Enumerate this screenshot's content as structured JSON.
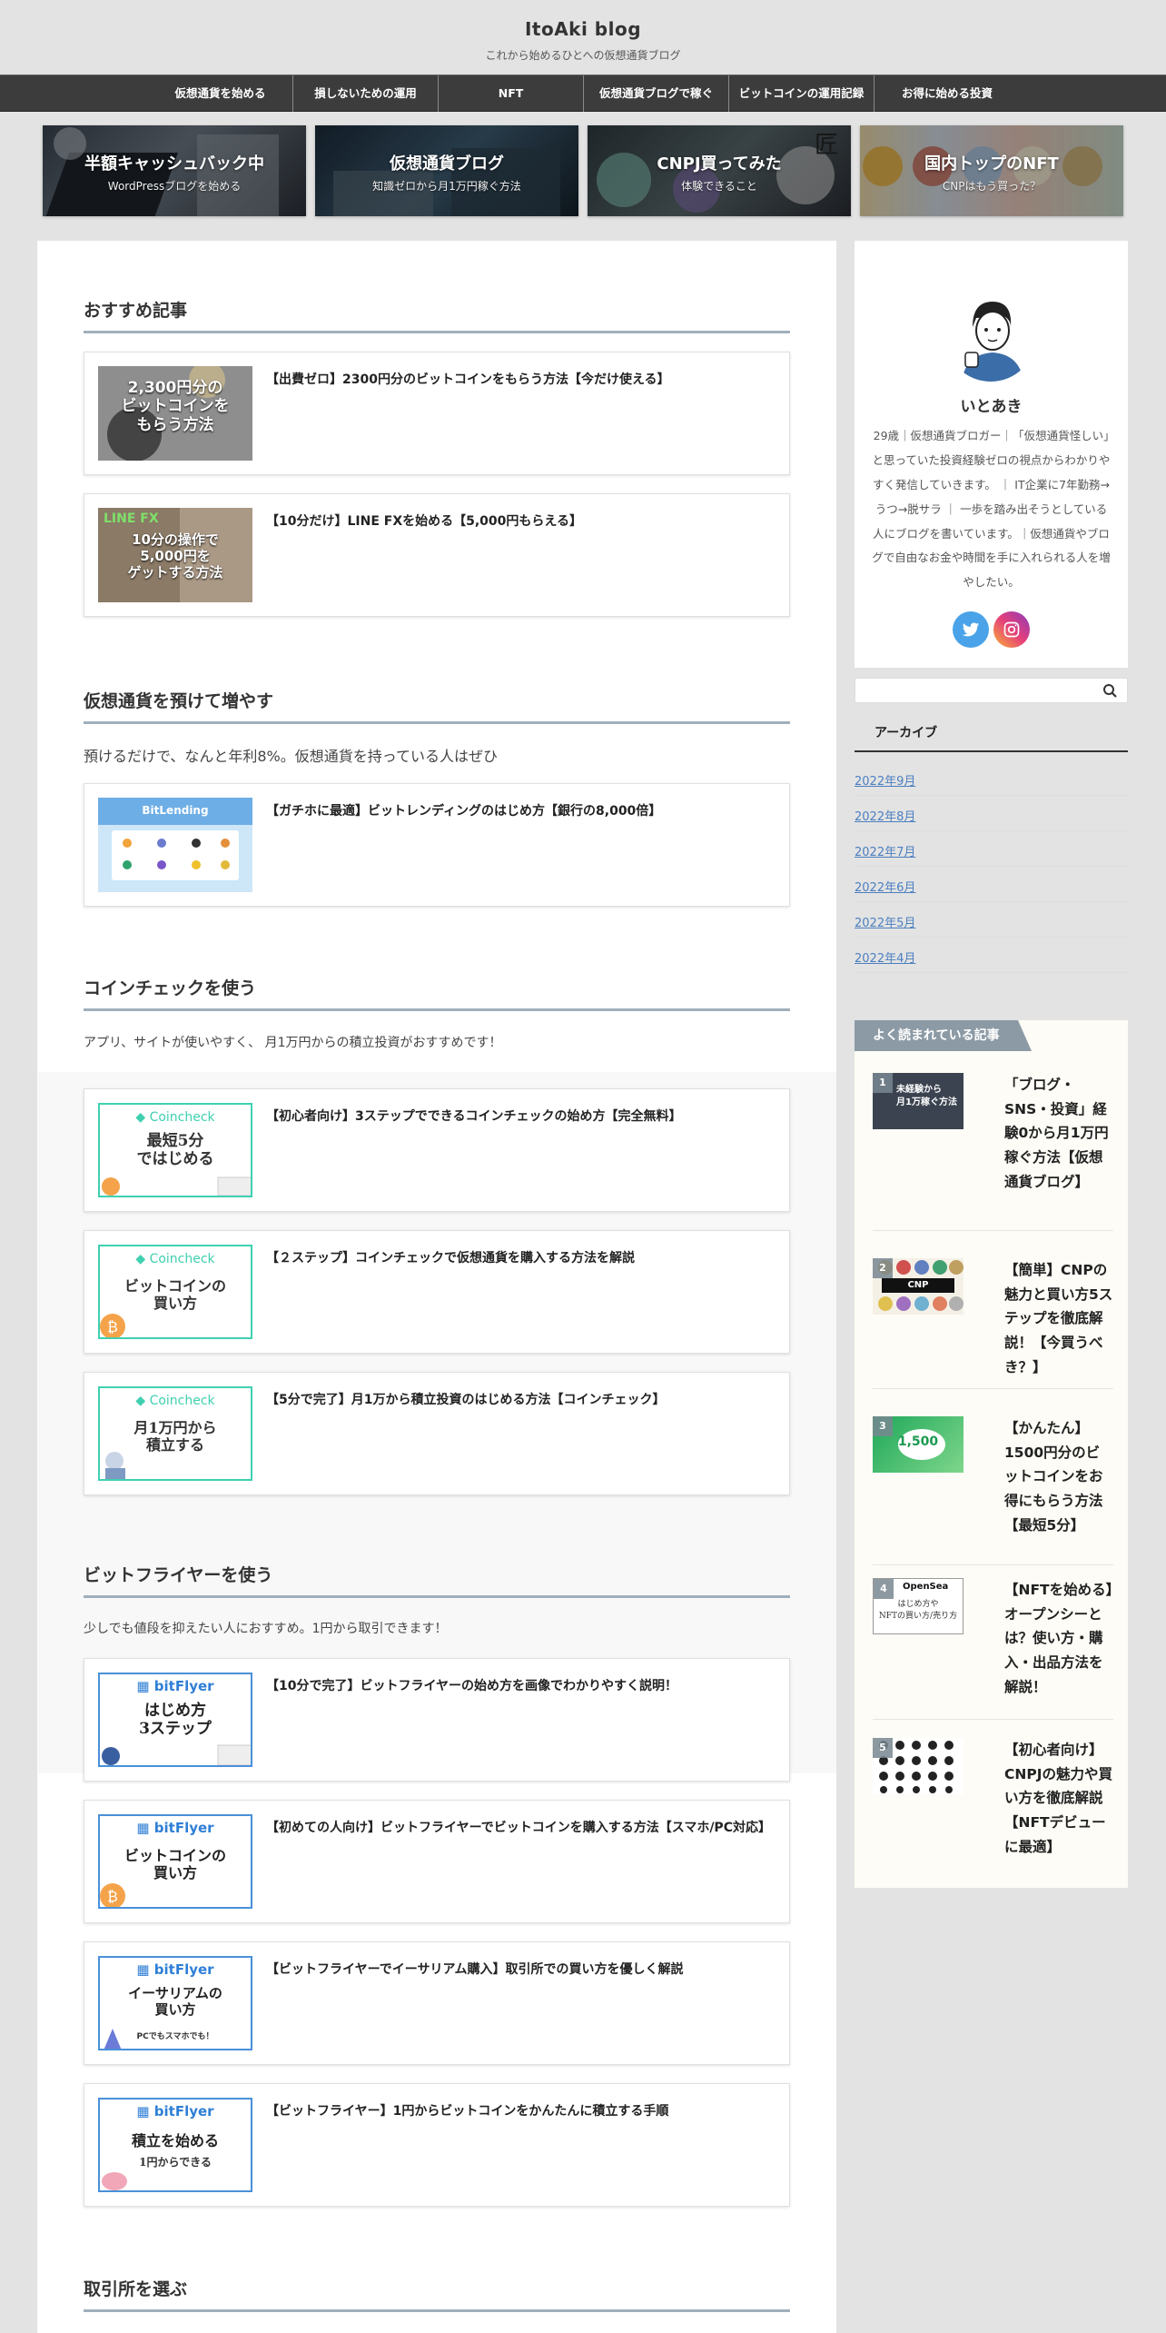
{
  "site": {
    "title": "ItoAki blog",
    "description": "これから始めるひとへの仮想通貨ブログ"
  },
  "nav": [
    "仮想通貨を始める",
    "損しないための運用",
    "NFT",
    "仮想通貨ブログで稼ぐ",
    "ビットコインの運用記録",
    "お得に始める投資"
  ],
  "carousel": [
    {
      "title": "半額キャッシュバック中",
      "subtitle": "WordPressブログを始める"
    },
    {
      "title": "仮想通貨ブログ",
      "subtitle": "知識ゼロから月1万円稼ぐ方法"
    },
    {
      "title": "CNPJ買ってみた",
      "subtitle": "体験できること"
    },
    {
      "title": "国内トップのNFT",
      "subtitle": "CNPはもう買った？"
    }
  ],
  "sections": {
    "recommended": {
      "heading": "おすすめ記事",
      "cards": [
        {
          "title": "【出費ゼロ】2300円分のビットコインをもらう方法【今だけ使える】",
          "thumb_text": "2,300円分の\nビットコインを\nもらう方法"
        },
        {
          "title": "【10分だけ】LINE FXを始める【5,000円もらえる】",
          "thumb_text": "10分の操作で\n5,000円を\nゲットする方法",
          "thumb_badge": "LINE FX"
        }
      ]
    },
    "lending": {
      "heading": "仮想通貨を預けて増やす",
      "text": "預けるだけで、なんと年利8%。仮想通貨を持っている人はぜひ",
      "cards": [
        {
          "title": "【ガチホに最適】ビットレンディングのはじめ方【銀行の8,000倍】",
          "thumb_brand": "BitLending"
        }
      ]
    },
    "coincheck": {
      "heading": "コインチェックを使う",
      "text": "アプリ、サイトが使いやすく、 月1万円からの積立投資がおすすめです！",
      "cards": [
        {
          "title": "【初心者向け】3ステップでできるコインチェックの始め方【完全無料】",
          "thumb_brand": "Coincheck",
          "thumb_text": "最短5分\nではじめる"
        },
        {
          "title": "【２ステップ】コインチェックで仮想通貨を購入する方法を解説",
          "thumb_brand": "Coincheck",
          "thumb_text": "ビットコインの\n買い方"
        },
        {
          "title": "【5分で完了】月1万から積立投資のはじめる方法【コインチェック】",
          "thumb_brand": "Coincheck",
          "thumb_text": "月1万円から\n積立する"
        }
      ]
    },
    "bitflyer": {
      "heading": "ビットフライヤーを使う",
      "text": "少しでも値段を抑えたい人におすすめ。1円から取引できます！",
      "cards": [
        {
          "title": "【10分で完了】ビットフライヤーの始め方を画像でわかりやすく説明！",
          "thumb_brand": "bitFlyer",
          "thumb_text": "はじめ方\n3ステップ"
        },
        {
          "title": "【初めての人向け】ビットフライヤーでビットコインを購入する方法【スマホ/PC対応】",
          "thumb_brand": "bitFlyer",
          "thumb_text": "ビットコインの\n買い方"
        },
        {
          "title": "【ビットフライヤーでイーサリアム購入】取引所での買い方を優しく解説",
          "thumb_brand": "bitFlyer",
          "thumb_text": "イーサリアムの\n買い方",
          "thumb_sub": "PCでもスマホでも！"
        },
        {
          "title": "【ビットフライヤー】1円からビットコインをかんたんに積立する手順",
          "thumb_brand": "bitFlyer",
          "thumb_text": "積立を始める",
          "thumb_sub": "1円からできる"
        }
      ]
    },
    "exchange": {
      "heading": "取引所を選ぶ"
    }
  },
  "profile": {
    "name": "いとあき",
    "bio": "29歳｜仮想通貨ブロガー｜「仮想通貨怪しい」と思っていた投資経験ゼロの視点からわかりやすく発信していきます。 ｜ IT企業に7年勤務→うつ→脱サラ ｜ 一歩を踏み出そうとしている人にブログを書いています。｜仮想通貨やブログで自由なお金や時間を手に入れられる人を増やしたい。"
  },
  "search": {
    "placeholder": ""
  },
  "archive": {
    "heading": "アーカイブ",
    "items": [
      "2022年9月",
      "2022年8月",
      "2022年7月",
      "2022年6月",
      "2022年5月",
      "2022年4月"
    ]
  },
  "popular": {
    "heading": "よく読まれている記事",
    "items": [
      {
        "rank": "1",
        "title": "「ブログ・SNS・投資」経験0から月1万円稼ぐ方法【仮想通貨ブログ】",
        "thumb_text": "未経験から\n月1万稼ぐ方法"
      },
      {
        "rank": "2",
        "title": "【簡単】CNPの魅力と買い方5ステップを徹底解説！【今買うべき？】",
        "thumb_text": "CNP"
      },
      {
        "rank": "3",
        "title": "【かんたん】1500円分のビットコインをお得にもらう方法【最短5分】",
        "thumb_text": "1,500"
      },
      {
        "rank": "4",
        "title": "【NFTを始める】オープンシーとは？使い方・購入・出品方法を解説！",
        "thumb_text": "OpenSea"
      },
      {
        "rank": "5",
        "title": "【初心者向け】CNPJの魅力や買い方を徹底解説【NFTデビューに最適】",
        "thumb_text": ""
      }
    ]
  },
  "colors": {
    "nav_bg": "#3c3c3c",
    "heading_underline": "#a0afbc",
    "link": "#4b7fbf",
    "popular_header": "#8c9aa5",
    "coincheck_green": "#3fd0b0",
    "bitflyer_blue": "#2f7fd6"
  }
}
